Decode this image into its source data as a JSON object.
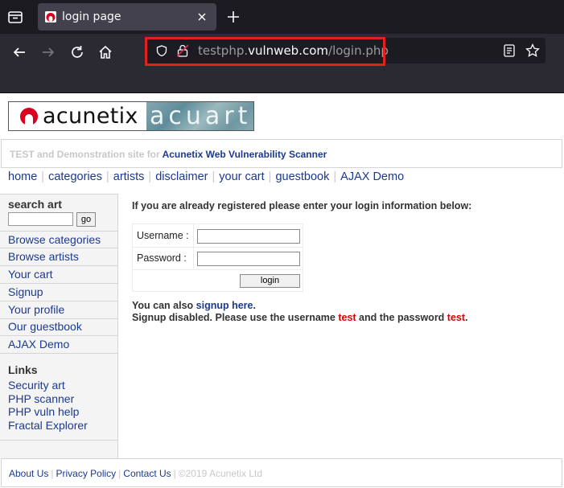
{
  "browser": {
    "tab_title": "login page",
    "url_prefix": "testphp.",
    "url_domain": "vulnweb.com",
    "url_path": "/login.php",
    "highlight_color": "#e0211f"
  },
  "logo": {
    "left_text": "acunetix",
    "right_text": "acuart"
  },
  "subheader": {
    "prefix": "TEST and Demonstration site for ",
    "link": "Acunetix Web Vulnerability Scanner"
  },
  "topnav": [
    "home",
    "categories",
    "artists",
    "disclaimer",
    "your cart",
    "guestbook",
    "AJAX Demo"
  ],
  "sidebar": {
    "search_title": "search art",
    "search_button": "go",
    "items": [
      "Browse categories",
      "Browse artists",
      "Your cart",
      "Signup",
      "Your profile",
      "Our guestbook",
      "AJAX Demo"
    ],
    "links_title": "Links",
    "links": [
      "Security art",
      "PHP scanner",
      "PHP vuln help",
      "Fractal Explorer"
    ]
  },
  "login": {
    "intro": "If you are already registered please enter your login information below:",
    "username_label": "Username :",
    "password_label": "Password :",
    "username_value": "",
    "password_value": "",
    "button": "login"
  },
  "notes": {
    "line1_prefix": "You can also ",
    "line1_link": "signup here",
    "line1_suffix": ".",
    "line2_a": "Signup disabled. Please use the username ",
    "line2_user": "test",
    "line2_b": " and the password ",
    "line2_pass": "test",
    "line2_c": "."
  },
  "footer": {
    "links": [
      "About Us",
      "Privacy Policy",
      "Contact Us"
    ],
    "copyright": "©2019 Acunetix Ltd"
  }
}
